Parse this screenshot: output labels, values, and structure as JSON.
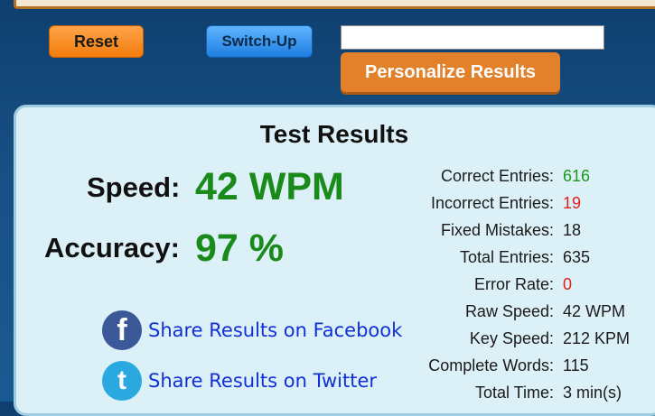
{
  "controls": {
    "reset_label": "Reset",
    "switch_label": "Switch-Up",
    "name_value": "",
    "personalize_label": "Personalize Results"
  },
  "results": {
    "title": "Test Results",
    "speed_label": "Speed:",
    "speed_value": "42 WPM",
    "accuracy_label": "Accuracy:",
    "accuracy_value": "97 %"
  },
  "stats": [
    {
      "label": "Correct Entries:",
      "value": "616",
      "color": "green"
    },
    {
      "label": "Incorrect Entries:",
      "value": "19",
      "color": "red"
    },
    {
      "label": "Fixed Mistakes:",
      "value": "18",
      "color": "default"
    },
    {
      "label": "Total Entries:",
      "value": "635",
      "color": "default"
    },
    {
      "label": "Error Rate:",
      "value": "0",
      "color": "red"
    },
    {
      "label": "Raw Speed:",
      "value": "42 WPM",
      "color": "default"
    },
    {
      "label": "Key Speed:",
      "value": "212 KPM",
      "color": "default"
    },
    {
      "label": "Complete Words:",
      "value": "115",
      "color": "default"
    },
    {
      "label": "Total Time:",
      "value": "3 min(s)",
      "color": "default"
    }
  ],
  "share": {
    "facebook_label": "Share Results on Facebook",
    "facebook_icon": "facebook-icon",
    "twitter_label": "Share Results on Twitter",
    "twitter_icon": "twitter-icon"
  },
  "colors": {
    "green": "#1a9a1a",
    "red": "#e11d1d",
    "accent_orange": "#e3812a",
    "link_blue": "#1030d8"
  }
}
